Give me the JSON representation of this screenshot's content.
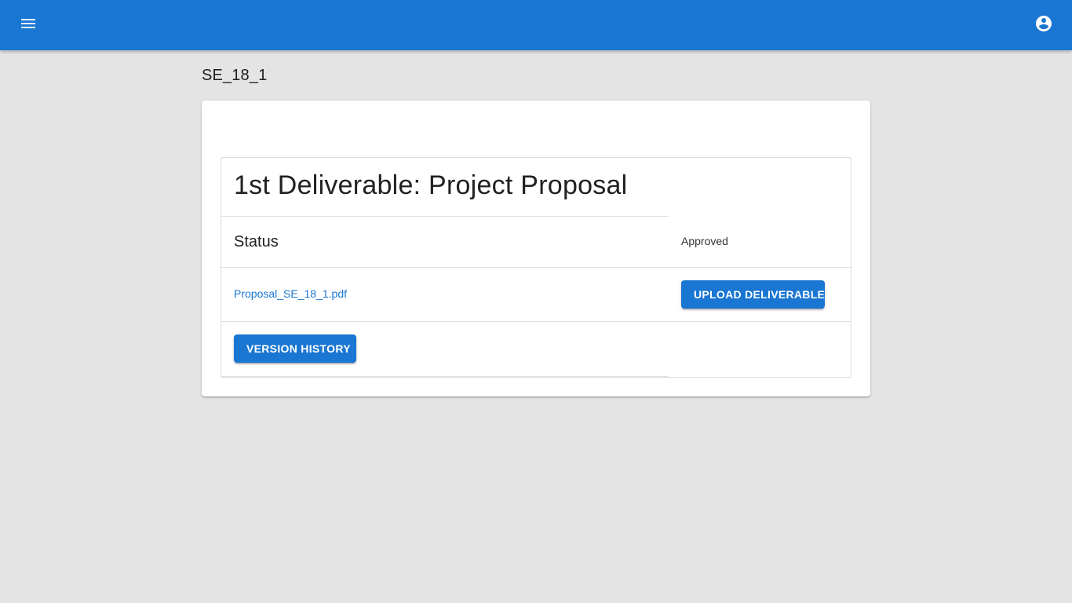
{
  "header": {
    "menu_icon": "menu-icon",
    "account_icon": "account-circle-icon",
    "background_color": "#1976d2"
  },
  "page": {
    "title": "SE_18_1"
  },
  "deliverable": {
    "title": "1st Deliverable: Project Proposal",
    "status_label": "Status",
    "status_value": "Approved",
    "file_name": "Proposal_SE_18_1.pdf",
    "upload_button_label": "UPLOAD DELIVERABLE",
    "version_history_button_label": "VERSION HISTORY"
  },
  "colors": {
    "accent": "#1976d2",
    "page_background": "#e4e4e4",
    "card_background": "#ffffff"
  }
}
